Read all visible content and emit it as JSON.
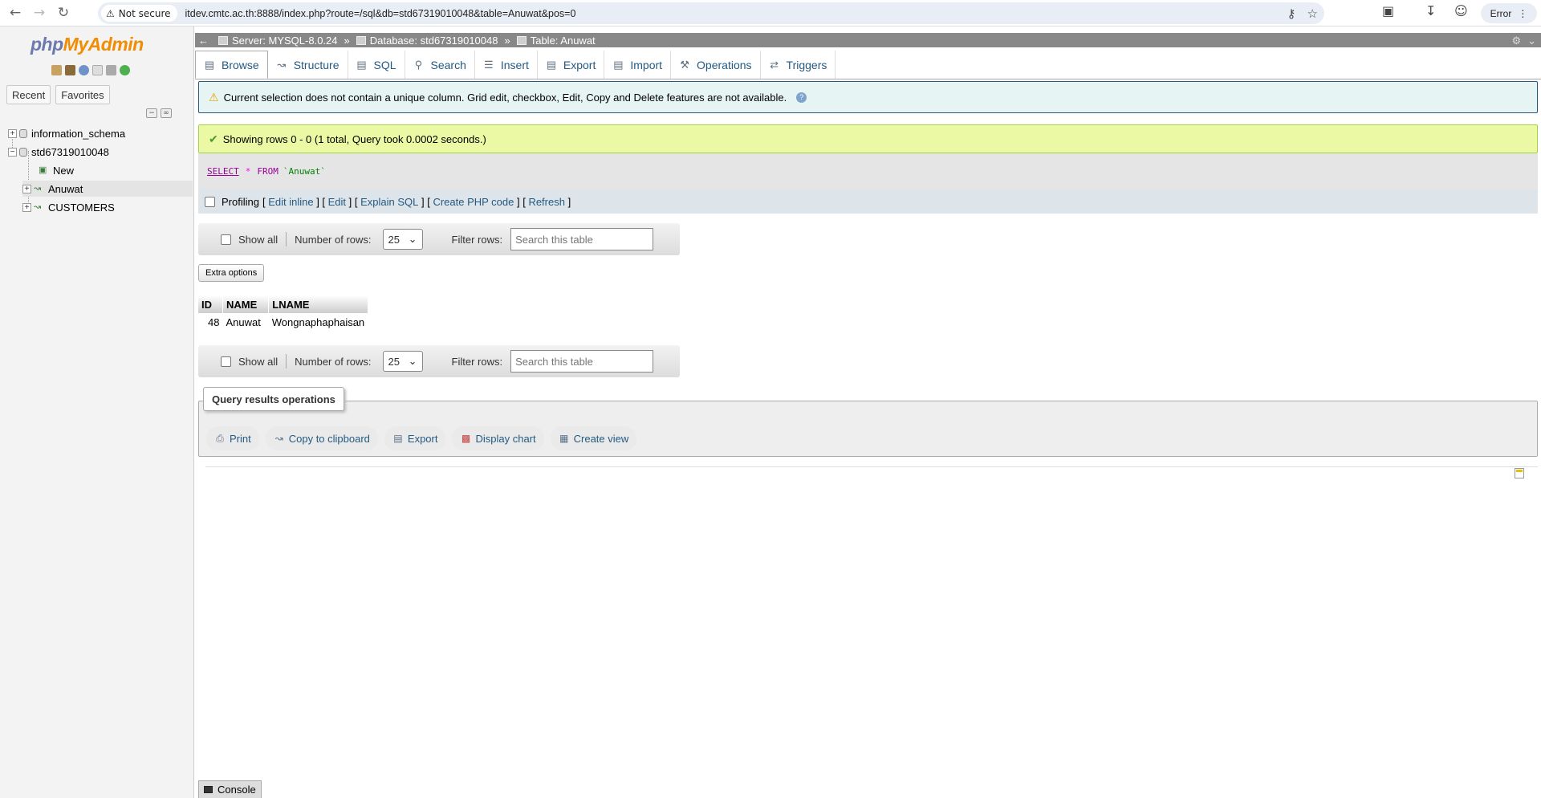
{
  "browser": {
    "security_label": "Not secure",
    "url": "itdev.cmtc.ac.th:8888/index.php?route=/sql&db=std67319010048&table=Anuwat&pos=0",
    "profile_status": "Error"
  },
  "sidebar": {
    "logo_php": "php",
    "logo_myadmin": "MyAdmin",
    "tabs": {
      "recent": "Recent",
      "favorites": "Favorites"
    },
    "tree": {
      "db1": "information_schema",
      "db2": "std67319010048",
      "new": "New",
      "table1": "Anuwat",
      "table2": "CUSTOMERS"
    }
  },
  "breadcrumb": {
    "server": "Server: MYSQL-8.0.24",
    "database": "Database: std67319010048",
    "table": "Table: Anuwat",
    "separator": "»"
  },
  "tabs": {
    "browse": "Browse",
    "structure": "Structure",
    "sql": "SQL",
    "search": "Search",
    "insert": "Insert",
    "export": "Export",
    "import": "Import",
    "operations": "Operations",
    "triggers": "Triggers"
  },
  "notice": "Current selection does not contain a unique column. Grid edit, checkbox, Edit, Copy and Delete features are not available.",
  "success": "Showing rows 0 - 0 (1 total, Query took 0.0002 seconds.)",
  "sql": {
    "select": "SELECT",
    "star": "*",
    "from": "FROM",
    "table": "`Anuwat`"
  },
  "profiling": {
    "label": "Profiling",
    "edit_inline": "Edit inline",
    "edit": "Edit",
    "explain": "Explain SQL",
    "php": "Create PHP code",
    "refresh": "Refresh"
  },
  "navigation": {
    "show_all": "Show all",
    "num_rows_label": "Number of rows:",
    "num_rows_value": "25",
    "filter_label": "Filter rows:",
    "filter_placeholder": "Search this table"
  },
  "extra_options": "Extra options",
  "table": {
    "headers": [
      "ID",
      "NAME",
      "LNAME"
    ],
    "rows": [
      [
        "48",
        "Anuwat",
        "Wongnaphaphaisan"
      ]
    ]
  },
  "query_ops": {
    "legend": "Query results operations",
    "print": "Print",
    "copy": "Copy to clipboard",
    "export": "Export",
    "chart": "Display chart",
    "view": "Create view"
  },
  "console": "Console",
  "colors": {
    "link": "#235a81",
    "notice_bg": "#e7f4f4",
    "success_bg": "#ebf8a4",
    "breadcrumb_bg": "#888888",
    "logo_orange": "#f28c00",
    "logo_blue": "#6c78af"
  }
}
